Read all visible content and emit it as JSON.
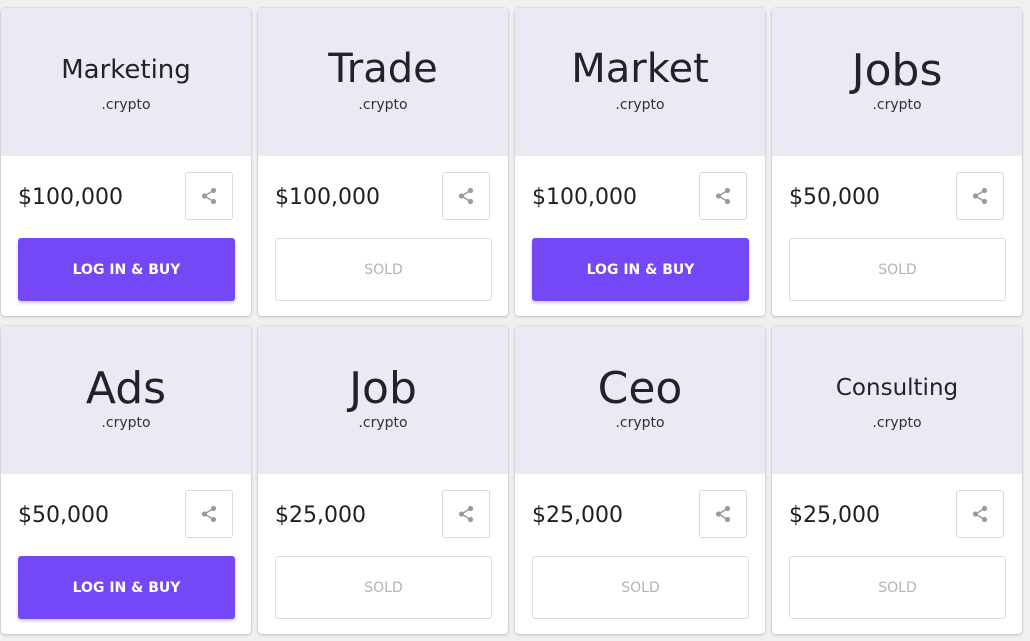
{
  "listings": [
    {
      "name": "Marketing",
      "tld": ".crypto",
      "price": "$100,000",
      "action": "LOG IN & BUY",
      "status": "available"
    },
    {
      "name": "Trade",
      "tld": ".crypto",
      "price": "$100,000",
      "action": "SOLD",
      "status": "sold"
    },
    {
      "name": "Market",
      "tld": ".crypto",
      "price": "$100,000",
      "action": "LOG IN & BUY",
      "status": "available"
    },
    {
      "name": "Jobs",
      "tld": ".crypto",
      "price": "$50,000",
      "action": "SOLD",
      "status": "sold"
    },
    {
      "name": "Ads",
      "tld": ".crypto",
      "price": "$50,000",
      "action": "LOG IN & BUY",
      "status": "available"
    },
    {
      "name": "Job",
      "tld": ".crypto",
      "price": "$25,000",
      "action": "SOLD",
      "status": "sold"
    },
    {
      "name": "Ceo",
      "tld": ".crypto",
      "price": "$25,000",
      "action": "SOLD",
      "status": "sold"
    },
    {
      "name": "Consulting",
      "tld": ".crypto",
      "price": "$25,000",
      "action": "SOLD",
      "status": "sold"
    }
  ],
  "icons": {
    "share": "share-icon"
  },
  "colors": {
    "buy_button": "#7448f6",
    "card_header": "#eaeaf5",
    "sold_text": "#b3b3bb"
  }
}
